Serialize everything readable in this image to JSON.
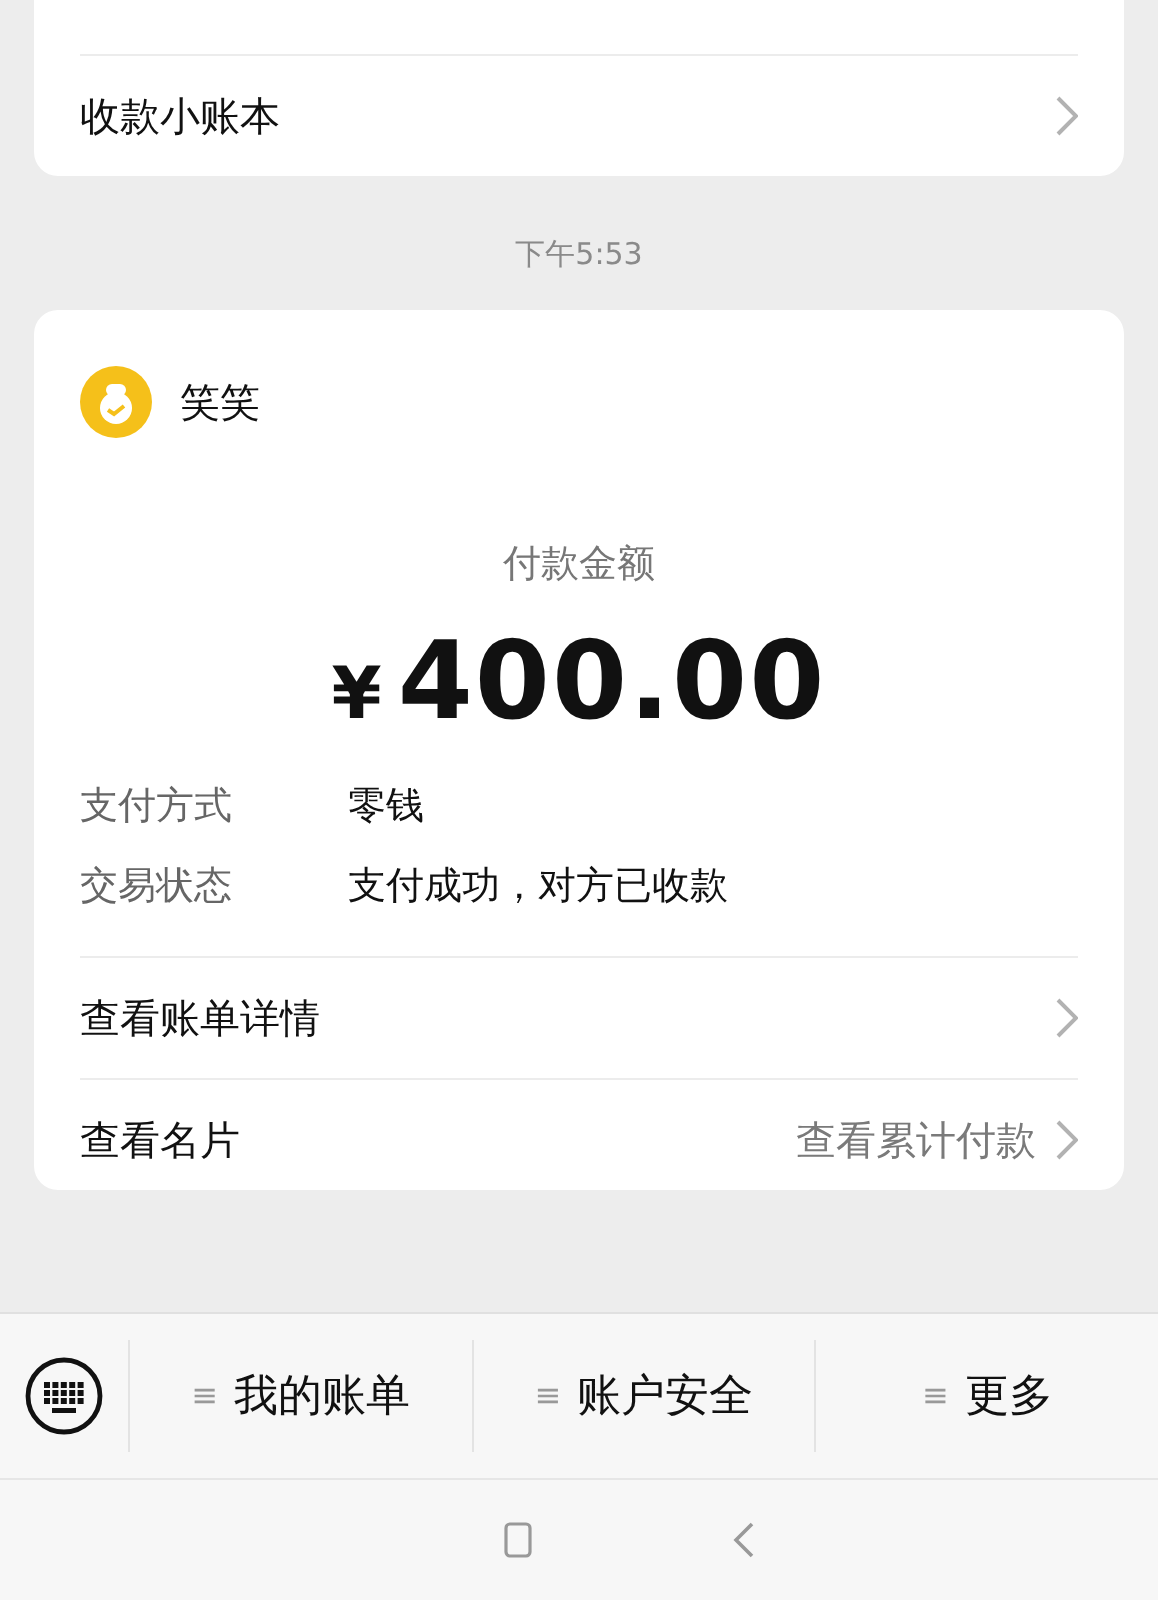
{
  "top_card": {
    "row": {
      "label": "收款小账本"
    }
  },
  "timestamp": "下午5:53",
  "payment_card": {
    "sender": "笑笑",
    "amount_label": "付款金额",
    "currency": "¥",
    "amount": "400.00",
    "details": [
      {
        "label": "支付方式",
        "value": "零钱"
      },
      {
        "label": "交易状态",
        "value": "支付成功，对方已收款"
      }
    ],
    "links": [
      {
        "label": "查看账单详情"
      },
      {
        "label": "查看名片",
        "hint": "查看累计付款"
      }
    ]
  },
  "menu_bar": {
    "items": [
      {
        "glyph": "≡",
        "label": "我的账单"
      },
      {
        "glyph": "≡",
        "label": "账户安全"
      },
      {
        "glyph": "≡",
        "label": "更多"
      }
    ]
  }
}
